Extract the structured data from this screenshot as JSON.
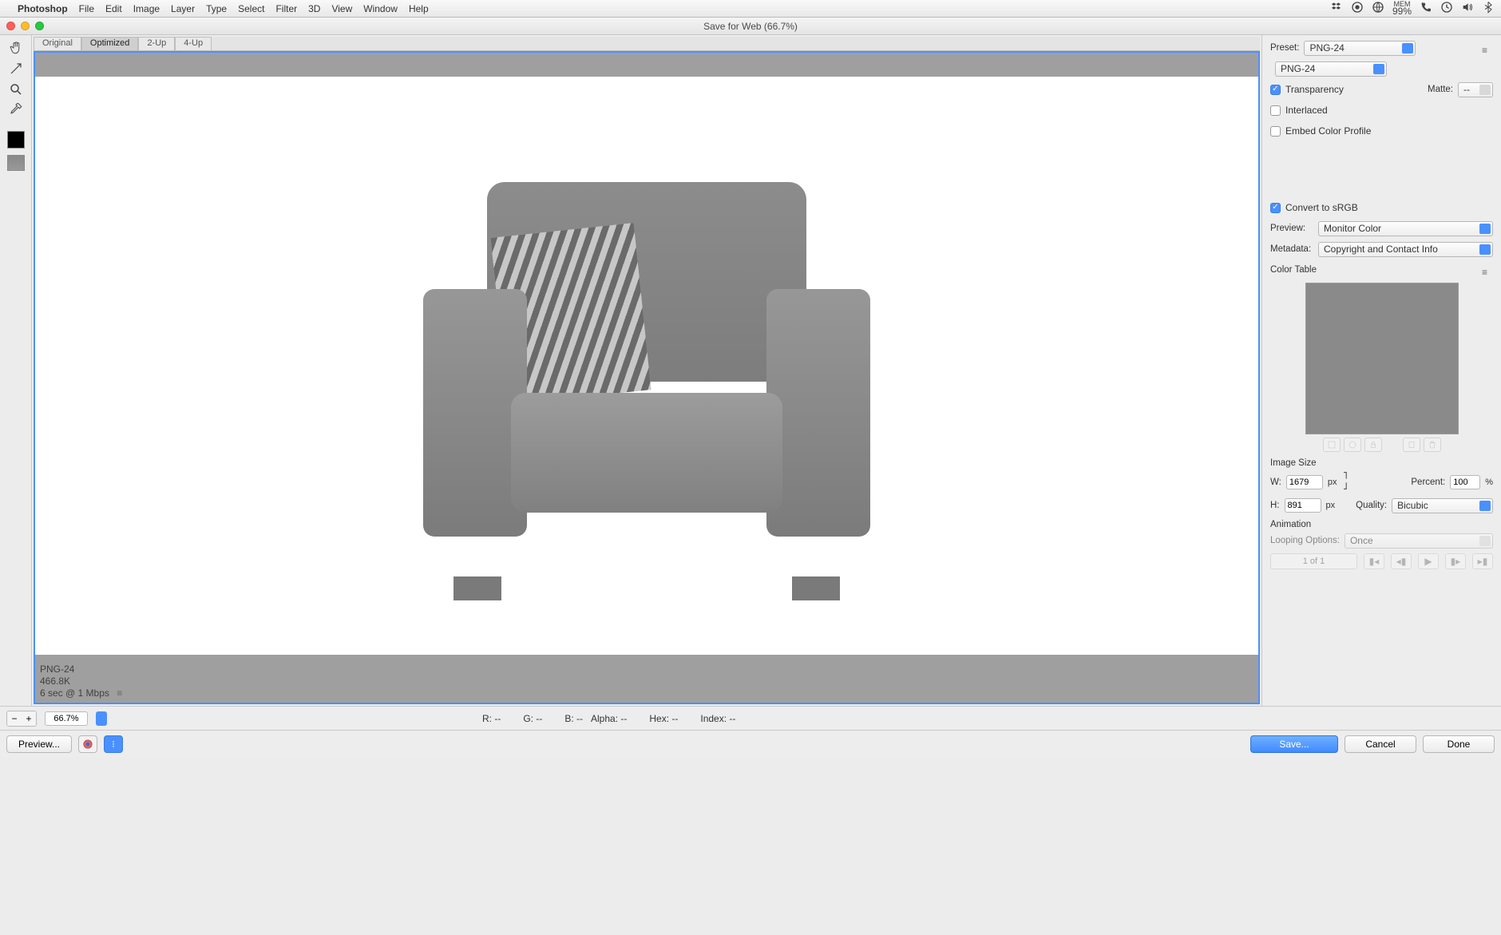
{
  "menubar": {
    "app": "Photoshop",
    "items": [
      "File",
      "Edit",
      "Image",
      "Layer",
      "Type",
      "Select",
      "Filter",
      "3D",
      "View",
      "Window",
      "Help"
    ],
    "mem": "99%"
  },
  "window": {
    "title": "Save for Web (66.7%)"
  },
  "tabs": [
    "Original",
    "Optimized",
    "2-Up",
    "4-Up"
  ],
  "active_tab": 1,
  "file_info": {
    "format": "PNG-24",
    "size": "466.8K",
    "speed": "6 sec @ 1 Mbps"
  },
  "panel": {
    "preset_label": "Preset:",
    "preset_value": "PNG-24",
    "format_value": "PNG-24",
    "transparency": {
      "label": "Transparency",
      "checked": true
    },
    "matte_label": "Matte:",
    "matte_value": "--",
    "interlaced": {
      "label": "Interlaced",
      "checked": false
    },
    "embed": {
      "label": "Embed Color Profile",
      "checked": false
    },
    "convert": {
      "label": "Convert to sRGB",
      "checked": true
    },
    "preview_label": "Preview:",
    "preview_value": "Monitor Color",
    "metadata_label": "Metadata:",
    "metadata_value": "Copyright and Contact Info",
    "color_table_label": "Color Table",
    "image_size_label": "Image Size",
    "w_label": "W:",
    "w_value": "1679",
    "px": "px",
    "h_label": "H:",
    "h_value": "891",
    "percent_label": "Percent:",
    "percent_value": "100",
    "pct": "%",
    "quality_label": "Quality:",
    "quality_value": "Bicubic",
    "animation_label": "Animation",
    "looping_label": "Looping Options:",
    "looping_value": "Once",
    "frame_count": "1 of 1"
  },
  "bottom": {
    "zoom": "66.7%",
    "r": "R: --",
    "g": "G: --",
    "b": "B: --",
    "alpha": "Alpha: --",
    "hex": "Hex: --",
    "index": "Index: --"
  },
  "actions": {
    "preview": "Preview...",
    "save": "Save...",
    "cancel": "Cancel",
    "done": "Done"
  }
}
